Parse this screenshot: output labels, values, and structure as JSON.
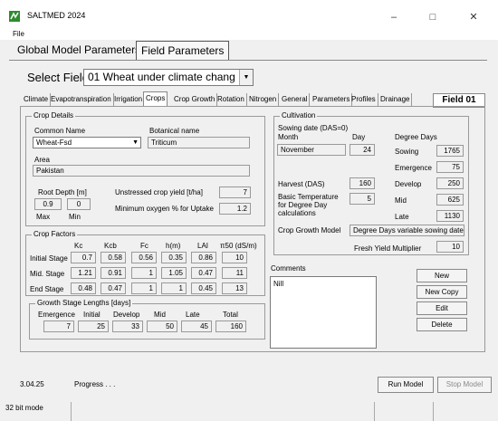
{
  "window": {
    "title": "SALTMED 2024",
    "min": "–",
    "max": "□",
    "close": "✕"
  },
  "menu": {
    "file": "File"
  },
  "main_tabs": [
    "Global Model Parameters",
    "Field Parameters"
  ],
  "select_field": {
    "label": "Select Field",
    "value": "01 Wheat under climate chang"
  },
  "sub_tabs": [
    "Climate",
    "Evapotranspiration",
    "Irrigation",
    "Crops",
    "Crop Growth",
    "Rotation",
    "Nitrogen",
    "General",
    "Parameters",
    "Profiles",
    "Drainage"
  ],
  "field_badge": "Field 01",
  "crop_details": {
    "title": "Crop Details",
    "common_name_label": "Common Name",
    "common_name": "Wheat-Fsd",
    "botanical_label": "Botanical name",
    "botanical": "Triticum",
    "area_label": "Area",
    "area": "Pakistan",
    "root_depth_label": "Root Depth [m]",
    "root_max": "0.9",
    "root_min": "0",
    "max_label": "Max",
    "min_label": "Min",
    "unstressed_label": "Unstressed crop yield [t/ha]",
    "unstressed": "7",
    "min_oxygen_label": "Minimum oxygen % for Uptake",
    "min_oxygen": "1.2"
  },
  "crop_factors": {
    "title": "Crop Factors",
    "headers": [
      "Kc",
      "Kcb",
      "Fc",
      "h(m)",
      "LAI",
      "π50 (dS/m)"
    ],
    "rows": [
      {
        "label": "Initial Stage",
        "values": [
          "0.7",
          "0.58",
          "0.56",
          "0.35",
          "0.86",
          "10"
        ]
      },
      {
        "label": "Mid. Stage",
        "values": [
          "1.21",
          "0.91",
          "1",
          "1.05",
          "0.47",
          "11"
        ]
      },
      {
        "label": "End Stage",
        "values": [
          "0.48",
          "0.47",
          "1",
          "1",
          "0.45",
          "13"
        ]
      }
    ]
  },
  "growth_stages": {
    "title": "Growth Stage Lengths [days]",
    "headers": [
      "Emergence",
      "Initial",
      "Develop",
      "Mid",
      "Late",
      "Total"
    ],
    "values": [
      "7",
      "25",
      "33",
      "50",
      "45",
      "160"
    ]
  },
  "cultivation": {
    "title": "Cultivation",
    "sowing_label": "Sowing date (DAS=0)",
    "month_label": "Month",
    "day_label": "Day",
    "month": "November",
    "day": "24",
    "harvest_label": "Harvest (DAS)",
    "harvest": "160",
    "basic_temp_label": "Basic Temperature for Degree Day calculations",
    "basic_temp": "5",
    "crop_growth_model_label": "Crop Growth Model",
    "crop_growth_model": "Degree Days variable sowing date",
    "degree_days_label": "Degree Days",
    "dd": [
      {
        "label": "Sowing",
        "value": "1765"
      },
      {
        "label": "Emergence",
        "value": "75"
      },
      {
        "label": "Develop",
        "value": "250"
      },
      {
        "label": "Mid",
        "value": "625"
      },
      {
        "label": "Late",
        "value": "1130"
      }
    ],
    "fresh_yield_label": "Fresh Yield Multiplier",
    "fresh_yield": "10"
  },
  "comments": {
    "label": "Comments",
    "text": "Nill"
  },
  "buttons": {
    "new": "New",
    "new_copy": "New Copy",
    "edit": "Edit",
    "delete": "Delete",
    "run": "Run Model",
    "stop": "Stop Model"
  },
  "status": {
    "version": "3.04.25",
    "progress": "Progress . . .",
    "mode": "32 bit mode"
  },
  "colors": {
    "icon_green": "#2e8b2e"
  }
}
